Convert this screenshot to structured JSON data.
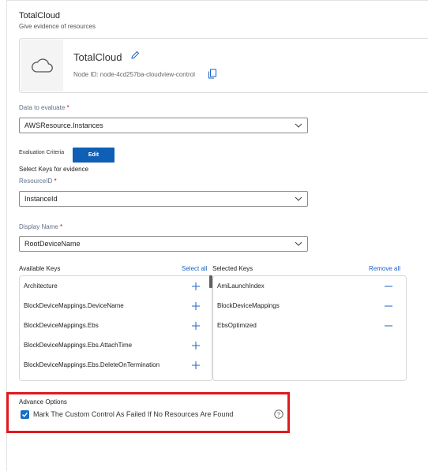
{
  "header": {
    "title": "TotalCloud",
    "subtitle": "Give evidence of resources"
  },
  "node": {
    "name": "TotalCloud",
    "id_text": "Node ID: node-4cd257ba-cloudview-control"
  },
  "data_to_evaluate": {
    "label": "Data to evaluate",
    "required_mark": "*",
    "value": "AWSResource.Instances"
  },
  "evaluation": {
    "criteria_label": "Evaluation Criteria",
    "edit_label": "Edit",
    "select_keys_label": "Select Keys for evidence"
  },
  "resource_id": {
    "label": "ResourceID",
    "required_mark": "*",
    "value": "InstanceId"
  },
  "display_name": {
    "label": "Display Name",
    "required_mark": "*",
    "value": "RootDeviceName"
  },
  "keys": {
    "available_label": "Available Keys",
    "select_all_label": "Select all",
    "selected_label": "Selected Keys",
    "remove_all_label": "Remove all",
    "available": [
      "Architecture",
      "BlockDeviceMappings.DeviceName",
      "BlockDeviceMappings.Ebs",
      "BlockDeviceMappings.Ebs.AttachTime",
      "BlockDeviceMappings.Ebs.DeleteOnTermination"
    ],
    "selected": [
      "AmiLaunchIndex",
      "BlockDeviceMappings",
      "EbsOptimized"
    ]
  },
  "advance": {
    "title": "Advance Options",
    "checkbox_label": "Mark The Custom Control As Failed If No Resources Are Found",
    "checked": true
  },
  "colors": {
    "accent": "#0e5fb5",
    "link": "#1a63c4",
    "highlight_frame": "#e0191f",
    "required": "#d0021b"
  },
  "icons": [
    "cloud-icon",
    "pencil-icon",
    "copy-icon",
    "chevron-down-icon",
    "plus-icon",
    "minus-icon",
    "check-icon",
    "help-icon"
  ]
}
